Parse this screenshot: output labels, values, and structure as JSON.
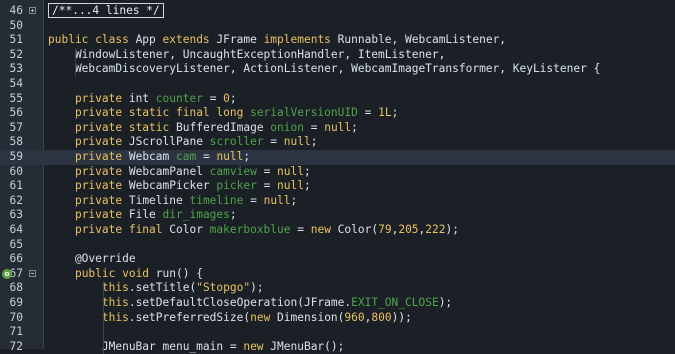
{
  "editor": {
    "lines": [
      {
        "n": "46",
        "collapsed": "/**...4 lines */"
      },
      {
        "n": "50",
        "text": ""
      },
      {
        "n": "51",
        "tokens": [
          [
            "kw",
            "public class "
          ],
          [
            "t",
            "App "
          ],
          [
            "kw",
            "extends "
          ],
          [
            "t",
            "JFrame "
          ],
          [
            "kw",
            "implements "
          ],
          [
            "t",
            "Runnable, WebcamListener,"
          ]
        ]
      },
      {
        "n": "52",
        "tokens": [
          [
            "t",
            "    WindowListener, UncaughtExceptionHandler, ItemListener,"
          ]
        ]
      },
      {
        "n": "53",
        "tokens": [
          [
            "t",
            "    WebcamDiscoveryListener, ActionListener, WebcamImageTransformer, KeyListener {"
          ]
        ]
      },
      {
        "n": "54",
        "text": ""
      },
      {
        "n": "55",
        "tokens": [
          [
            "t",
            "    "
          ],
          [
            "kw",
            "private "
          ],
          [
            "t",
            "int "
          ],
          [
            "fld",
            "counter"
          ],
          [
            "t",
            " = "
          ],
          [
            "cn",
            "0"
          ],
          [
            "t",
            ";"
          ]
        ]
      },
      {
        "n": "56",
        "tokens": [
          [
            "t",
            "    "
          ],
          [
            "kw",
            "private static final long "
          ],
          [
            "fld",
            "serialVersionUID"
          ],
          [
            "t",
            " = "
          ],
          [
            "cn",
            "1L"
          ],
          [
            "t",
            ";"
          ]
        ]
      },
      {
        "n": "57",
        "tokens": [
          [
            "t",
            "    "
          ],
          [
            "kw",
            "private static "
          ],
          [
            "t",
            "BufferedImage "
          ],
          [
            "fld",
            "onion"
          ],
          [
            "t",
            " = "
          ],
          [
            "kw",
            "null"
          ],
          [
            "t",
            ";"
          ]
        ]
      },
      {
        "n": "58",
        "tokens": [
          [
            "t",
            "    "
          ],
          [
            "kw",
            "private "
          ],
          [
            "t",
            "JScrollPane "
          ],
          [
            "fld",
            "scroller"
          ],
          [
            "t",
            " = "
          ],
          [
            "kw",
            "null"
          ],
          [
            "t",
            ";"
          ]
        ]
      },
      {
        "n": "59",
        "current": true,
        "tokens": [
          [
            "t",
            "    "
          ],
          [
            "kw",
            "private "
          ],
          [
            "t",
            "Webcam "
          ],
          [
            "fld",
            "cam"
          ],
          [
            "t",
            " = "
          ],
          [
            "kw",
            "null"
          ],
          [
            "t",
            ";"
          ]
        ]
      },
      {
        "n": "60",
        "tokens": [
          [
            "t",
            "    "
          ],
          [
            "kw",
            "private "
          ],
          [
            "t",
            "WebcamPanel "
          ],
          [
            "fld",
            "camview"
          ],
          [
            "t",
            " = "
          ],
          [
            "kw",
            "null"
          ],
          [
            "t",
            ";"
          ]
        ]
      },
      {
        "n": "61",
        "tokens": [
          [
            "t",
            "    "
          ],
          [
            "kw",
            "private "
          ],
          [
            "t",
            "WebcamPicker "
          ],
          [
            "fld",
            "picker"
          ],
          [
            "t",
            " = "
          ],
          [
            "kw",
            "null"
          ],
          [
            "t",
            ";"
          ]
        ]
      },
      {
        "n": "62",
        "tokens": [
          [
            "t",
            "    "
          ],
          [
            "kw",
            "private "
          ],
          [
            "t",
            "Timeline "
          ],
          [
            "fld",
            "timeline"
          ],
          [
            "t",
            " = "
          ],
          [
            "kw",
            "null"
          ],
          [
            "t",
            ";"
          ]
        ]
      },
      {
        "n": "63",
        "tokens": [
          [
            "t",
            "    "
          ],
          [
            "kw",
            "private "
          ],
          [
            "t",
            "File "
          ],
          [
            "fld",
            "dir_images"
          ],
          [
            "t",
            ";"
          ]
        ]
      },
      {
        "n": "64",
        "tokens": [
          [
            "t",
            "    "
          ],
          [
            "kw",
            "private final "
          ],
          [
            "t",
            "Color "
          ],
          [
            "fld",
            "makerboxblue"
          ],
          [
            "t",
            " = "
          ],
          [
            "kw",
            "new "
          ],
          [
            "t",
            "Color("
          ],
          [
            "cn",
            "79"
          ],
          [
            "t",
            ","
          ],
          [
            "cn",
            "205"
          ],
          [
            "t",
            ","
          ],
          [
            "cn",
            "222"
          ],
          [
            "t",
            ");"
          ]
        ]
      },
      {
        "n": "65",
        "text": ""
      },
      {
        "n": "66",
        "tokens": [
          [
            "t",
            "    @Override"
          ]
        ]
      },
      {
        "n": "67",
        "badge": "o",
        "fold": "minus",
        "tokens": [
          [
            "t",
            "    "
          ],
          [
            "kw",
            "public void "
          ],
          [
            "t",
            "run() {"
          ]
        ]
      },
      {
        "n": "68",
        "tokens": [
          [
            "t",
            "        "
          ],
          [
            "kw",
            "this"
          ],
          [
            "t",
            ".setTitle("
          ],
          [
            "str",
            "\"Stopgo\""
          ],
          [
            "t",
            ");"
          ]
        ]
      },
      {
        "n": "69",
        "tokens": [
          [
            "t",
            "        "
          ],
          [
            "kw",
            "this"
          ],
          [
            "t",
            ".setDefaultCloseOperation(JFrame."
          ],
          [
            "const",
            "EXIT_ON_CLOSE"
          ],
          [
            "t",
            ");"
          ]
        ]
      },
      {
        "n": "70",
        "tokens": [
          [
            "t",
            "        "
          ],
          [
            "kw",
            "this"
          ],
          [
            "t",
            ".setPreferredSize("
          ],
          [
            "kw",
            "new "
          ],
          [
            "t",
            "Dimension("
          ],
          [
            "cn",
            "960"
          ],
          [
            "t",
            ","
          ],
          [
            "cn",
            "800"
          ],
          [
            "t",
            "));"
          ]
        ]
      },
      {
        "n": "71",
        "text": ""
      },
      {
        "n": "72",
        "tokens": [
          [
            "t",
            "        JMenuBar menu_main = "
          ],
          [
            "kw",
            "new "
          ],
          [
            "t",
            "JMenuBar();"
          ]
        ]
      }
    ]
  }
}
